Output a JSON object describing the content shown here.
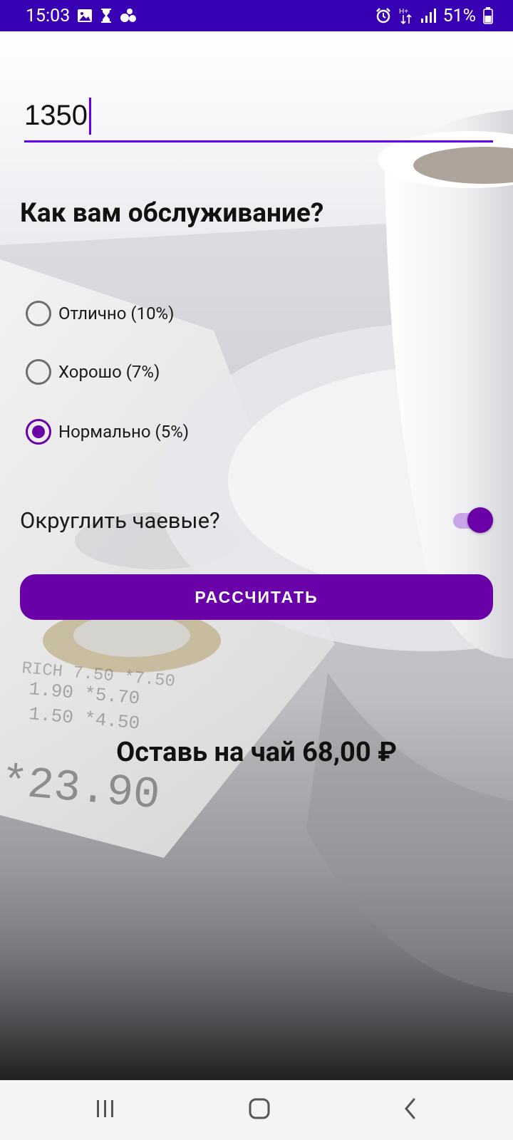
{
  "status_bar": {
    "time": "15:03",
    "battery": "51%",
    "icons_left": [
      "image-icon",
      "hourglass-icon",
      "bubbles-icon"
    ],
    "icons_right": [
      "alarm-icon",
      "data-arrows-icon",
      "signal-icon",
      "battery-icon"
    ]
  },
  "form": {
    "amount_value": "1350",
    "question": "Как вам обслуживание?",
    "options": [
      {
        "label": "Отлично (10%)",
        "checked": false
      },
      {
        "label": "Хорошо (7%)",
        "checked": false
      },
      {
        "label": "Нормально (5%)",
        "checked": true
      }
    ],
    "round_label": "Округлить чаевые?",
    "round_on": true,
    "calc_label": "РАССЧИТАТЬ",
    "result": "Оставь на чай 68,00 ₽"
  },
  "colors": {
    "accent": "#6a00a8",
    "status_bar": "#3700b3",
    "input_underline": "#6200ee"
  },
  "nav_bar": {
    "icons": [
      "recent-apps-icon",
      "home-icon",
      "back-icon"
    ]
  }
}
